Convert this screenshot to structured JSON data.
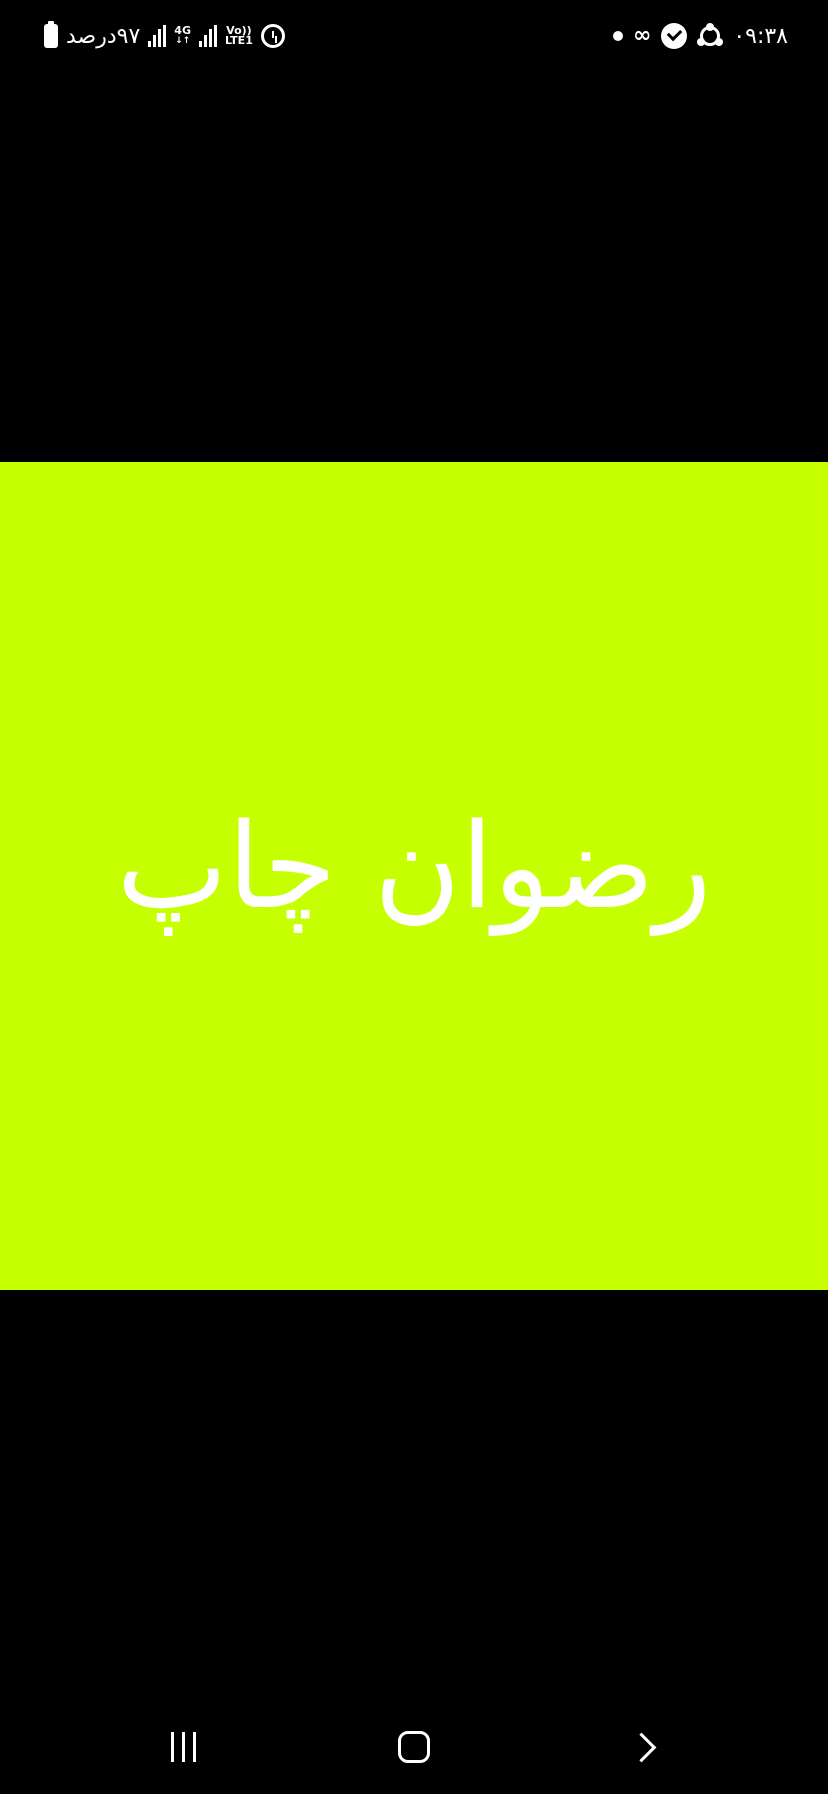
{
  "status_bar": {
    "battery_text": "۹۷درصد",
    "network_type": "4G",
    "volte_top": "Vo))",
    "volte_bottom": "LTE1",
    "infinity_symbol": "∞",
    "time": "۰۹:۳۸",
    "icons": [
      "battery-icon",
      "signal-icon",
      "4g-icon",
      "signal-icon",
      "volte-icon",
      "alarm-icon",
      "dot-icon",
      "infinity-icon",
      "shield-check-icon",
      "share-icon"
    ]
  },
  "image": {
    "background_color": "#c6ff00",
    "text": "رضوان چاپ",
    "text_color": "#ffffff"
  },
  "nav_bar": {
    "buttons": [
      "recents-icon",
      "home-icon",
      "back-icon"
    ]
  },
  "colors": {
    "page_background": "#000000",
    "accent": "#c6ff00"
  }
}
